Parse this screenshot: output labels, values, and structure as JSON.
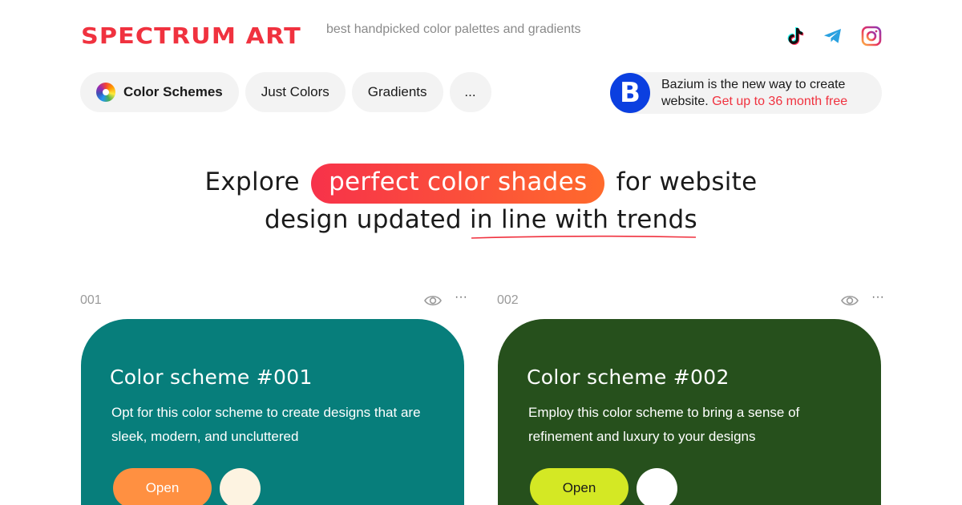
{
  "header": {
    "logo": "SPECTRUM ART",
    "tagline": "best handpicked color palettes and gradients",
    "social": [
      "tiktok-icon",
      "telegram-icon",
      "instagram-icon"
    ]
  },
  "nav": {
    "items": [
      {
        "label": "Color Schemes",
        "active": true
      },
      {
        "label": "Just Colors"
      },
      {
        "label": "Gradients"
      },
      {
        "label": "..."
      }
    ]
  },
  "ad": {
    "logo": "B",
    "text": "Bazium is the new way to create website.",
    "cta": "Get up to 36 month free"
  },
  "hero": {
    "part1": "Explore",
    "highlight": "perfect color shades",
    "part2": "for website",
    "part3": "design updated",
    "underlined": "in line with trends"
  },
  "cards": [
    {
      "number": "001",
      "title": "Color scheme #001",
      "description": "Opt for this color scheme to create designs that are sleek, modern, and uncluttered",
      "button": "Open",
      "menu": "···",
      "colors": {
        "background": "#077e7b",
        "button": "#ff9041",
        "button_text": "#ffffff",
        "swatch": "#fdf3e1"
      }
    },
    {
      "number": "002",
      "title": "Color scheme #002",
      "description": "Employ this color scheme to bring a sense of refinement and luxury to your designs",
      "button": "Open",
      "menu": "···",
      "colors": {
        "background": "#26501c",
        "button": "#d4e824",
        "button_text": "#1a1a1a",
        "swatch": "#ffffff"
      }
    }
  ],
  "colors": {
    "brand": "#f0323f",
    "accent_blue": "#0b3fe0"
  }
}
